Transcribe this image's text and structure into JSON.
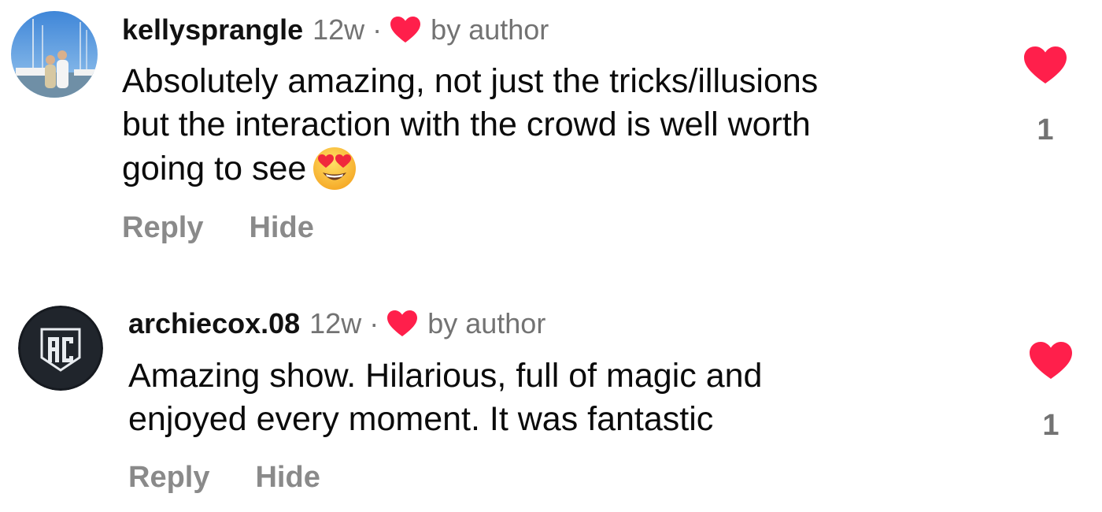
{
  "colors": {
    "heart": "#ff1f4b",
    "muted": "#737373",
    "text": "#0b0b0b"
  },
  "comments": [
    {
      "username": "kellysprangle",
      "time": "12w",
      "separator": "·",
      "liked_by_author": "by author",
      "lines": [
        "Absolutely amazing, not just the tricks/illusions",
        "but the interaction with the crowd is well worth",
        "going to see"
      ],
      "emoji": "smiling-face-with-heart-eyes",
      "actions": {
        "reply": "Reply",
        "hide": "Hide"
      },
      "like_count": "1",
      "avatar": "photo-avatar"
    },
    {
      "username": "archiecox.08",
      "time": "12w",
      "separator": "·",
      "liked_by_author": "by author",
      "lines": [
        "Amazing show. Hilarious, full of magic and",
        "enjoyed every moment. It was fantastic"
      ],
      "actions": {
        "reply": "Reply",
        "hide": "Hide"
      },
      "like_count": "1",
      "avatar": "ac-logo-avatar"
    }
  ]
}
